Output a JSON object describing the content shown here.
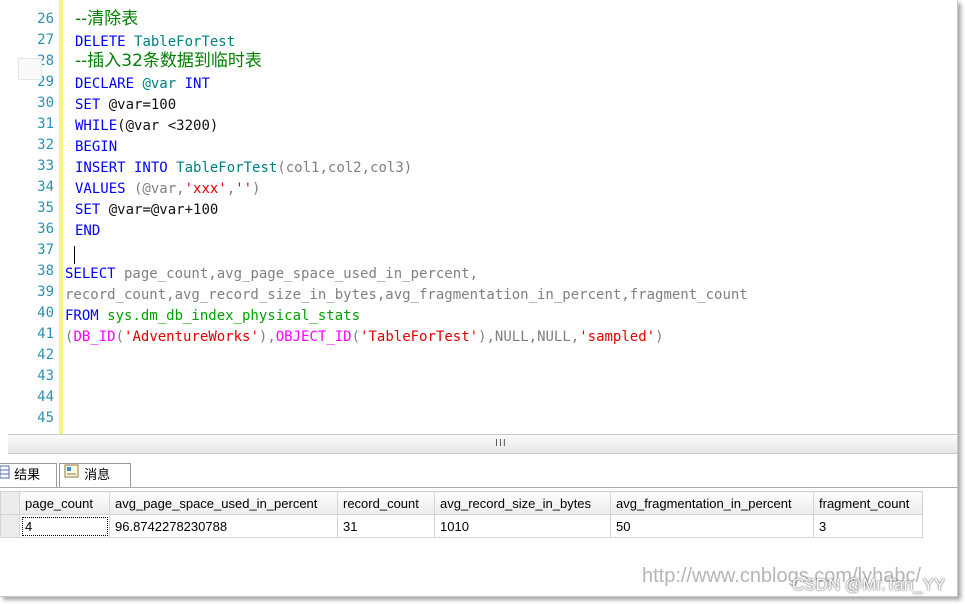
{
  "editor": {
    "line_numbers": [
      "26",
      "27",
      "28",
      "29",
      "30",
      "31",
      "32",
      "33",
      "34",
      "35",
      "36",
      "37",
      "38",
      "39",
      "40",
      "41",
      "42",
      "43",
      "44",
      "45"
    ],
    "lines": {
      "l26": "--清除表",
      "l27a": "DELETE",
      "l27b": "TableForTest",
      "l28": "--插入32条数据到临时表",
      "l29a": "DECLARE",
      "l29b": "@var",
      "l29c": "INT",
      "l30a": "SET",
      "l30b": "@var=100",
      "l31a": "WHILE",
      "l31b": "(@var <3200)",
      "l32": "BEGIN",
      "l33a": "INSERT INTO",
      "l33b": "TableForTest",
      "l33c": "(col1,col2,col3)",
      "l34a": "VALUES",
      "l34b": " (@var,",
      "l34c": "'xxx'",
      "l34d": ",",
      "l34e": "''",
      "l34f": ")",
      "l35a": "SET",
      "l35b": "@var=@var+100",
      "l36": "END",
      "l38a": "SELECT",
      "l38b": " page_count,avg_page_space_used_in_percent,",
      "l39": "record_count,avg_record_size_in_bytes,avg_fragmentation_in_percent,fragment_count",
      "l40a": "FROM",
      "l40b": " sys.dm_db_index_physical_stats",
      "l41a": "(",
      "l41b": "DB_ID",
      "l41c": "(",
      "l41d": "'AdventureWorks'",
      "l41e": "),",
      "l41f": "OBJECT_ID",
      "l41g": "(",
      "l41h": "'TableForTest'",
      "l41i": "),NULL,NULL,",
      "l41j": "'sampled'",
      "l41k": ")"
    }
  },
  "scrollbar": {
    "grip": "III"
  },
  "tabs": [
    {
      "label": "结果",
      "icon": "grid-icon"
    },
    {
      "label": "消息",
      "icon": "message-icon"
    }
  ],
  "results": {
    "columns": [
      "page_count",
      "avg_page_space_used_in_percent",
      "record_count",
      "avg_record_size_in_bytes",
      "avg_fragmentation_in_percent",
      "fragment_count"
    ],
    "rows": [
      {
        "row_header": "",
        "cells": [
          "4",
          "96.8742278230788",
          "31",
          "1010",
          "50",
          "3"
        ]
      }
    ]
  },
  "watermark": {
    "text": "http://www.cnblogs.com/lyhabc/",
    "overlay": "CSDN @Mr.Tan_YY"
  },
  "colors": {
    "keyword": "#0000ff",
    "string": "#e00000",
    "comment": "#008000",
    "linenumber": "#2b91af",
    "system": "#00a000",
    "function": "#ff00ff"
  }
}
